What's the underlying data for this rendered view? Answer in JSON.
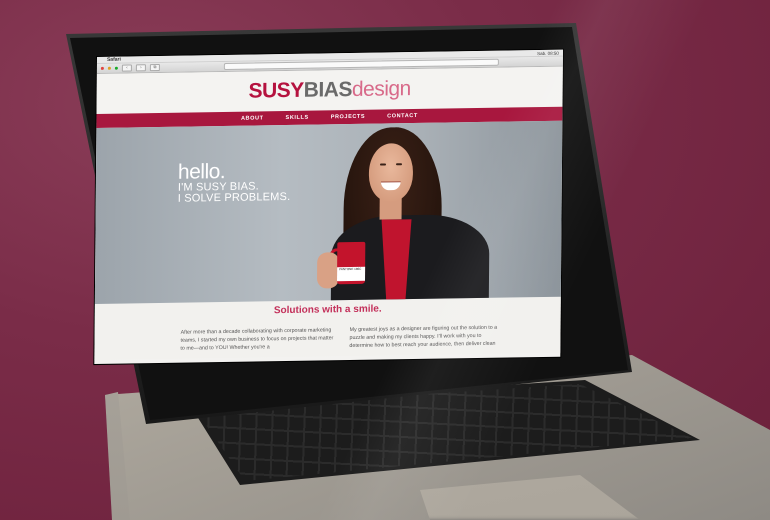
{
  "menubar": {
    "app_name": "Safari",
    "clock": "Sab. 08:50"
  },
  "toolbar": {
    "back_label": "‹",
    "forward_label": "›",
    "sidebar_label": "⧉"
  },
  "site": {
    "logo": {
      "part1": "SUSY",
      "part2": "BIAS",
      "part3": "design"
    },
    "nav": [
      "ABOUT",
      "SKILLS",
      "PROJECTS",
      "CONTACT"
    ],
    "hero": {
      "hello": "hello.",
      "line1": "I'M SUSY BIAS.",
      "line2": "I SOLVE PROBLEMS."
    },
    "mug_label": "PANTONE 186C",
    "tagline": "Solutions with a smile.",
    "col1": "After more than a decade collaborating with corporate marketing teams, I started my own business to focus on projects that matter to me—and to YOU! Whether you're a",
    "col2": "My greatest joys as a designer are figuring out the solution to a puzzle and making my clients happy. I'll work with you to determine how to best reach your audience, then deliver clean"
  },
  "colors": {
    "brand": "#a8173e",
    "logo_pink": "#d86a8a",
    "background": "#7a2c48"
  }
}
